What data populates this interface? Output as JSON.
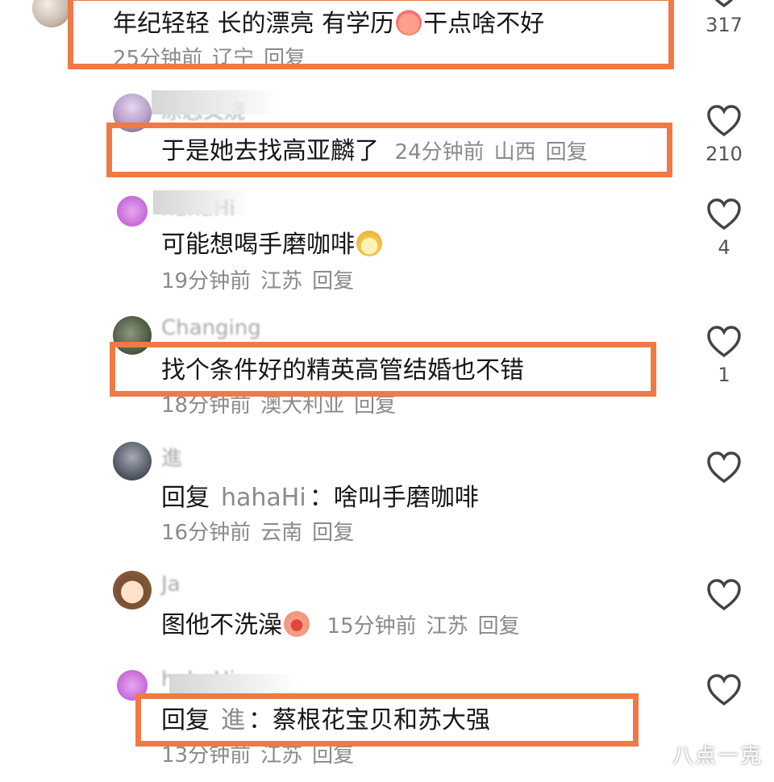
{
  "comments": [
    {
      "text": "年纪轻轻 长的漂亮 有学历",
      "text_after_emoji": "干点啥不好",
      "emoji": "sweat-emoji",
      "time": "25分钟前",
      "location": "辽宁",
      "reply_label": "回复",
      "likes": "317",
      "highlighted": true
    },
    {
      "username": "凉志又烧",
      "text": "于是她去找高亚麟了",
      "time": "24分钟前",
      "location": "山西",
      "reply_label": "回复",
      "likes": "210",
      "highlighted": true
    },
    {
      "text": "可能想喝手磨咖啡",
      "emoji": "dog-face-emoji",
      "time": "19分钟前",
      "location": "江苏",
      "reply_label": "回复",
      "likes": "4",
      "highlighted": false
    },
    {
      "username": "Changing",
      "text": "找个条件好的精英高管结婚也不错",
      "time": "18分钟前",
      "location": "澳大利亚",
      "reply_label": "回复",
      "likes": "1",
      "highlighted": true
    },
    {
      "username": "進",
      "reply_prefix": "回复",
      "reply_to": "hahaHi",
      "text": "：啥叫手磨咖啡",
      "time": "16分钟前",
      "location": "云南",
      "reply_label": "回复",
      "likes": "",
      "highlighted": false
    },
    {
      "username": "Ja",
      "text": "图他不洗澡",
      "emoji": "crying-emoji",
      "time": "15分钟前",
      "location": "江苏",
      "reply_label": "回复",
      "likes": "",
      "highlighted": false
    },
    {
      "reply_prefix": "回复",
      "reply_to": "進",
      "text": "：蔡根花宝贝和苏大强",
      "time": "13分钟前",
      "location": "江苏",
      "reply_label": "回复",
      "likes": "",
      "highlighted": true
    }
  ],
  "watermark": "八点一克",
  "colors": {
    "highlight": "#ef7a45",
    "meta_text": "#8a8a8a",
    "main_text": "#161616"
  }
}
